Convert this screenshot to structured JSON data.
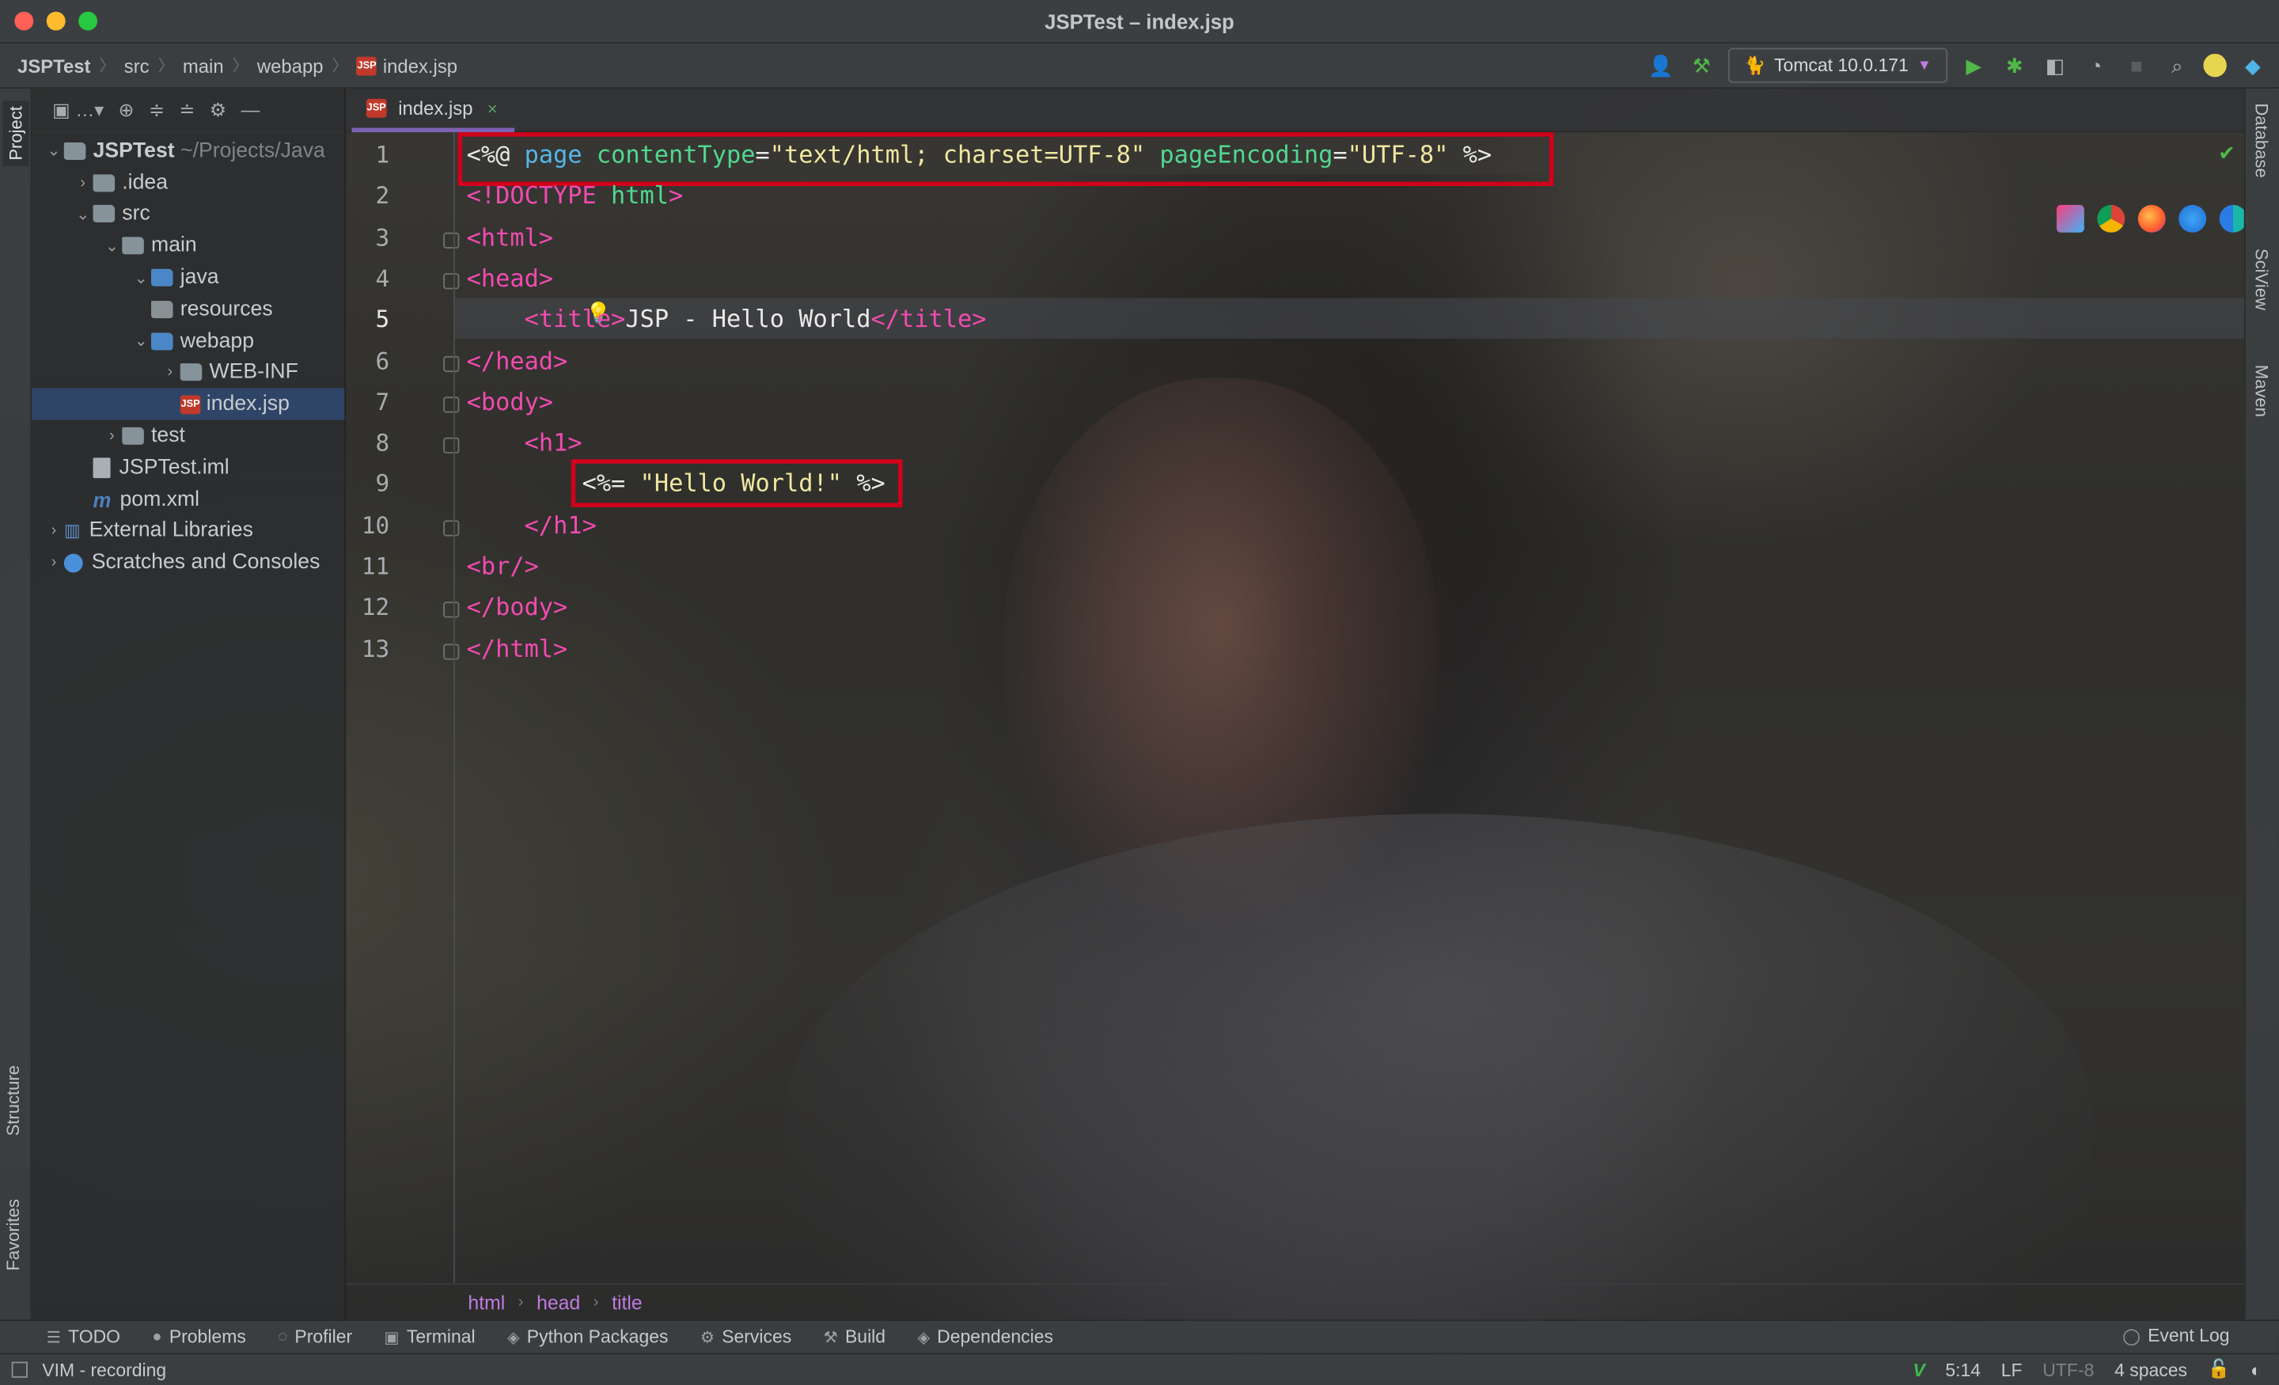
{
  "window": {
    "title": "JSPTest – index.jsp"
  },
  "breadcrumb": [
    "JSPTest",
    "src",
    "main",
    "webapp",
    "index.jsp"
  ],
  "run_config": {
    "label": "Tomcat 10.0.171"
  },
  "left_tabs": {
    "project": "Project",
    "structure": "Structure",
    "favorites": "Favorites"
  },
  "right_tabs": {
    "database": "Database",
    "sciview": "SciView",
    "maven": "Maven"
  },
  "project_tree": [
    {
      "label": "JSPTest",
      "suffix": "~/Projects/Java",
      "indent": 0,
      "arrow": "down",
      "icon": "module-folder"
    },
    {
      "label": ".idea",
      "indent": 1,
      "arrow": "right",
      "icon": "folder"
    },
    {
      "label": "src",
      "indent": 1,
      "arrow": "down",
      "icon": "folder"
    },
    {
      "label": "main",
      "indent": 2,
      "arrow": "down",
      "icon": "folder"
    },
    {
      "label": "java",
      "indent": 3,
      "arrow": "down",
      "icon": "source-folder"
    },
    {
      "label": "resources",
      "indent": 3,
      "arrow": "",
      "icon": "resources-folder"
    },
    {
      "label": "webapp",
      "indent": 3,
      "arrow": "down",
      "icon": "web-folder"
    },
    {
      "label": "WEB-INF",
      "indent": 4,
      "arrow": "right",
      "icon": "folder"
    },
    {
      "label": "index.jsp",
      "indent": 4,
      "arrow": "",
      "icon": "jsp-file",
      "selected": true
    },
    {
      "label": "test",
      "indent": 2,
      "arrow": "right",
      "icon": "folder"
    },
    {
      "label": "JSPTest.iml",
      "indent": 1,
      "arrow": "",
      "icon": "iml-file"
    },
    {
      "label": "pom.xml",
      "indent": 1,
      "arrow": "",
      "icon": "maven-file"
    },
    {
      "label": "External Libraries",
      "indent": 0,
      "arrow": "right",
      "icon": "library"
    },
    {
      "label": "Scratches and Consoles",
      "indent": 0,
      "arrow": "right",
      "icon": "scratch"
    }
  ],
  "editor_tab": {
    "label": "index.jsp",
    "close": "×"
  },
  "code_lines": [
    {
      "num": "1",
      "html": "<span class=\"plain\">&lt;%@ </span><span class=\"kw\">page </span><span class=\"attr\">contentType</span><span class=\"plain\">=</span><span class=\"str\">\"text/html; charset=UTF-8\" </span><span class=\"attr\">pageEncoding</span><span class=\"plain\">=</span><span class=\"str\">\"UTF-8\" </span><span class=\"plain\">%&gt;</span>"
    },
    {
      "num": "2",
      "html": "<span class=\"tag\">&lt;!DOCTYPE </span><span class=\"attr\">html</span><span class=\"tag\">&gt;</span>"
    },
    {
      "num": "3",
      "html": "<span class=\"tag\">&lt;html&gt;</span>"
    },
    {
      "num": "4",
      "html": "<span class=\"tag\">&lt;head&gt;</span>"
    },
    {
      "num": "5",
      "html": "    <span class=\"tag\">&lt;title&gt;</span><span class=\"plain\">JSP - Hello World</span><span class=\"tag\">&lt;/title&gt;</span>"
    },
    {
      "num": "6",
      "html": "<span class=\"tag\">&lt;/head&gt;</span>"
    },
    {
      "num": "7",
      "html": "<span class=\"tag\">&lt;body&gt;</span>"
    },
    {
      "num": "8",
      "html": "    <span class=\"tag\">&lt;h1&gt;</span>"
    },
    {
      "num": "9",
      "html": "        <span class=\"plain\">&lt;%= </span><span class=\"str\">\"Hello World!\" </span><span class=\"plain\">%&gt;</span>"
    },
    {
      "num": "10",
      "html": "    <span class=\"tag\">&lt;/h1&gt;</span>"
    },
    {
      "num": "11",
      "html": "<span class=\"tag\">&lt;br/&gt;</span>"
    },
    {
      "num": "12",
      "html": "<span class=\"tag\">&lt;/body&gt;</span>"
    },
    {
      "num": "13",
      "html": "<span class=\"tag\">&lt;/html&gt;</span>"
    }
  ],
  "editor_breadcrumb": [
    "html",
    "head",
    "title"
  ],
  "tool_windows": [
    "TODO",
    "Problems",
    "Profiler",
    "Terminal",
    "Python Packages",
    "Services",
    "Build",
    "Dependencies"
  ],
  "event_log": "Event Log",
  "status": {
    "mode": "VIM - recording",
    "position": "5:14",
    "line_ending": "LF",
    "encoding": "UTF-8",
    "indent": "4 spaces"
  },
  "colors": {
    "tag": "#f14bb0",
    "attribute": "#50d890",
    "string": "#f0e8a0",
    "keyword": "#52b7e8",
    "highlight_box": "#d0021b",
    "selection": "#2f4567"
  }
}
